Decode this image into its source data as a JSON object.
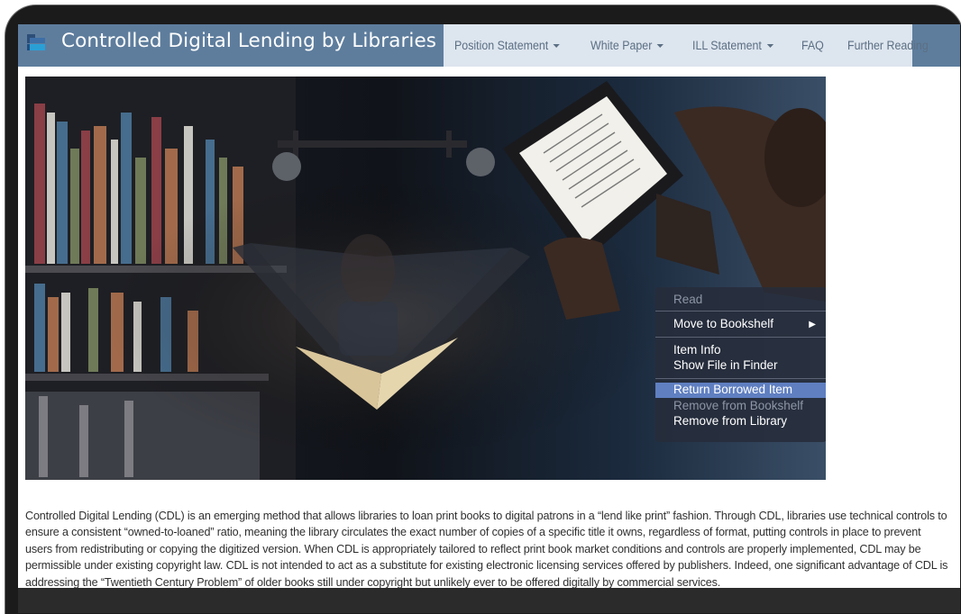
{
  "site": {
    "title": "Controlled Digital Lending by Libraries",
    "logo_icon": "book-stack-logo-icon"
  },
  "nav": {
    "items": [
      {
        "label": "Position Statement",
        "dropdown": true
      },
      {
        "label": "White Paper",
        "dropdown": true
      },
      {
        "label": "ILL Statement",
        "dropdown": true
      },
      {
        "label": "FAQ",
        "dropdown": false
      },
      {
        "label": "Further Reading",
        "dropdown": false
      }
    ]
  },
  "hero_menu": {
    "items": [
      {
        "label": "Read",
        "state": "disabled"
      },
      {
        "label": "Move to Bookshelf",
        "state": "normal",
        "submenu": true
      },
      {
        "label": "Item Info",
        "state": "normal"
      },
      {
        "label": "Show File in Finder",
        "state": "normal"
      },
      {
        "label": "Return Borrowed Item",
        "state": "highlighted"
      },
      {
        "label": "Remove from Bookshelf",
        "state": "disabled"
      },
      {
        "label": "Remove from Library",
        "state": "normal"
      }
    ],
    "submenu_arrow": "▶"
  },
  "intro": {
    "text": "Controlled Digital Lending (CDL) is an emerging method that allows libraries to loan print books to digital patrons in a “lend like print” fashion. Through CDL, libraries use technical controls to ensure a consistent “owned-to-loaned” ratio, meaning the library circulates the exact number of copies of a specific title it owns, regardless of format, putting controls in place to prevent users from redistributing or copying the digitized version. When CDL is appropriately tailored to reflect print book market conditions and controls are properly implemented, CDL may be permissible under existing copyright law. CDL is not intended to act as a substitute for existing electronic licensing services offered by publishers. Indeed, one significant advantage of CDL is addressing the “Twentieth Century Problem” of older books still under copyright but unlikely ever to be offered digitally by commercial services."
  },
  "colors": {
    "navbar": "#5e7d9d",
    "menu_bg": "#dde5ee",
    "menu_text": "#5c6f84",
    "highlight": "#5f7fc1"
  }
}
